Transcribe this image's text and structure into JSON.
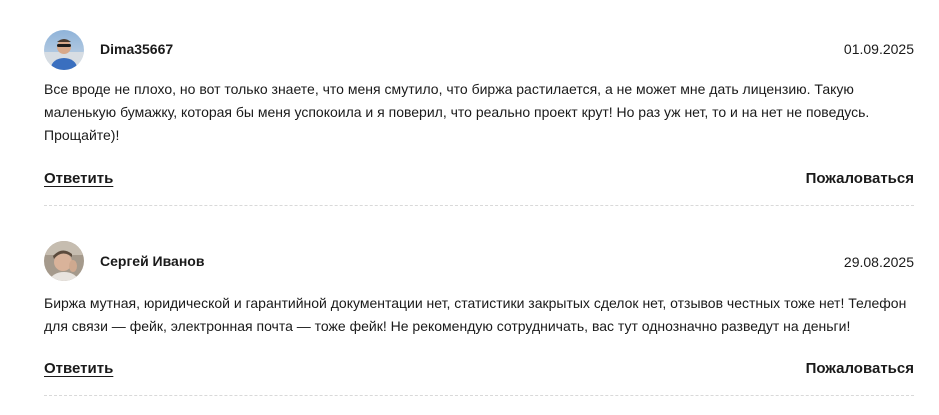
{
  "comments": [
    {
      "author": "Dima35667",
      "date": "01.09.2025",
      "avatar": "user-avatar-photo",
      "text": "Все вроде не плохо, но вот только знаете, что меня смутило, что биржа растилается, а не может мне дать лицензию. Такую маленькую бумажку, которая бы меня успокоила и я поверил, что реально проект крут! Но раз уж нет, то и на нет не поведусь. Прощайте)!",
      "reply_label": "Ответить",
      "report_label": "Пожаловаться"
    },
    {
      "author": "Сергей Иванов",
      "date": "29.08.2025",
      "avatar": "user-avatar-photo",
      "text": "Биржа мутная, юридической и гарантийной документации нет, статистики закрытых сделок нет, отзывов честных тоже нет! Телефон для связи — фейк, электронная почта — тоже фейк! Не рекомендую сотрудничать, вас тут однозначно разведут на деньги!",
      "reply_label": "Ответить",
      "report_label": "Пожаловаться"
    }
  ]
}
